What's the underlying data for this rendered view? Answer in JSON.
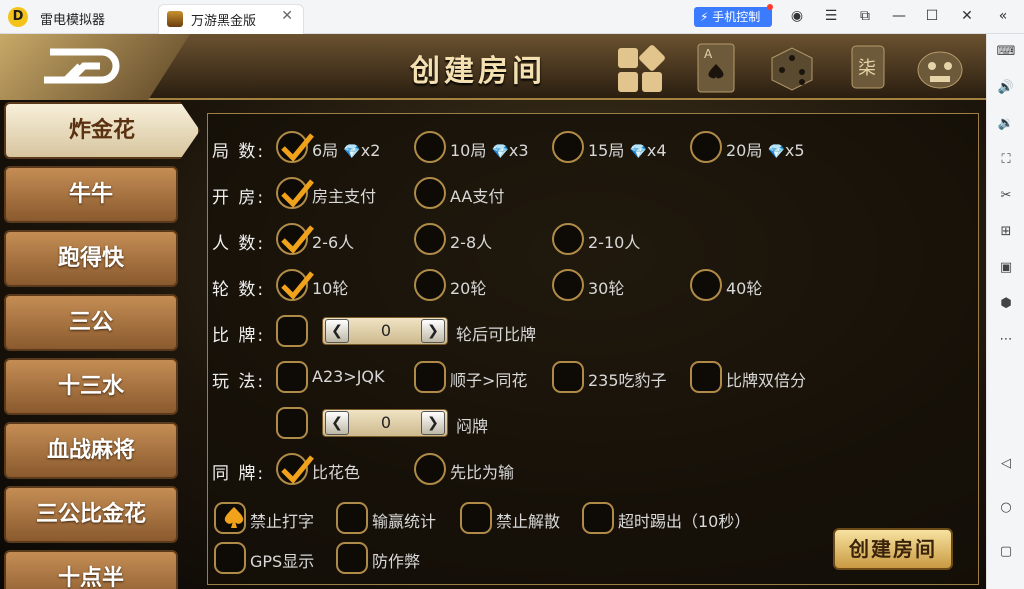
{
  "titlebar": {
    "app_name": "雷电模拟器",
    "tab_label": "万游黑金版",
    "phone_control": "手机控制"
  },
  "header": {
    "title": "创建房间"
  },
  "nav": {
    "items": [
      "炸金花",
      "牛牛",
      "跑得快",
      "三公",
      "十三水",
      "血战麻将",
      "三公比金花",
      "十点半"
    ],
    "active_index": 0
  },
  "rows": {
    "rounds": {
      "label": "局  数:",
      "options": [
        "6局",
        "10局",
        "15局",
        "20局"
      ],
      "costs": [
        "x2",
        "x3",
        "x4",
        "x5"
      ],
      "checked": 0
    },
    "room": {
      "label": "开  房:",
      "options": [
        "房主支付",
        "AA支付"
      ],
      "checked": 0
    },
    "players": {
      "label": "人  数:",
      "options": [
        "2-6人",
        "2-8人",
        "2-10人"
      ],
      "checked": 0
    },
    "turns": {
      "label": "轮  数:",
      "options": [
        "10轮",
        "20轮",
        "30轮",
        "40轮"
      ],
      "checked": 0
    },
    "compare": {
      "label": "比  牌:",
      "value": "0",
      "suffix": "轮后可比牌"
    },
    "play": {
      "label": "玩  法:",
      "options": [
        "A23>JQK",
        "顺子>同花",
        "235吃豹子",
        "比牌双倍分"
      ]
    },
    "blind": {
      "value": "0",
      "suffix": "闷牌"
    },
    "same": {
      "label": "同  牌:",
      "options": [
        "比花色",
        "先比为输"
      ],
      "checked": 0
    },
    "extra": {
      "options": [
        "禁止打字",
        "输赢统计",
        "禁止解散",
        "超时踢出（10秒）",
        "GPS显示",
        "防作弊"
      ]
    }
  },
  "create_button": "创建房间"
}
